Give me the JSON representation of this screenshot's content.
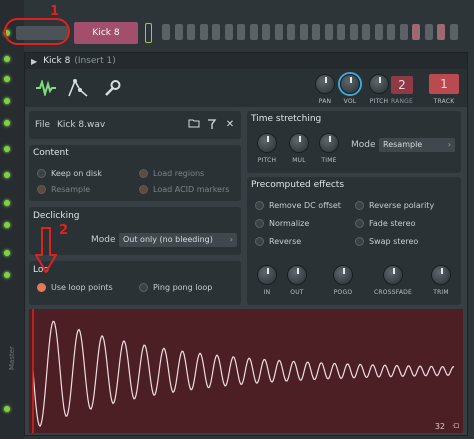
{
  "channel": {
    "name": "Kick 8"
  },
  "window": {
    "title": "Kick 8",
    "subtitle": "(Insert 1)"
  },
  "header": {
    "knobs": [
      {
        "label": "PAN"
      },
      {
        "label": "VOL"
      },
      {
        "label": "PITCH"
      }
    ],
    "range_label": "RANGE",
    "range_value": "2",
    "track_label": "TRACK",
    "track_value": "1"
  },
  "file": {
    "label": "File",
    "value": "Kick 8.wav"
  },
  "content": {
    "title": "Content",
    "options": [
      {
        "label": "Keep on disk",
        "on": false
      },
      {
        "label": "Load regions",
        "dim": true
      },
      {
        "label": "Resample",
        "dim": true
      },
      {
        "label": "Load ACID markers",
        "dim": true
      }
    ]
  },
  "declicking": {
    "title": "Declicking",
    "mode_label": "Mode",
    "mode_value": "Out only (no bleeding)"
  },
  "loop": {
    "title": "Loo",
    "options": [
      {
        "label": "Use loop points",
        "on": true
      },
      {
        "label": "Ping pong loop",
        "on": false
      }
    ]
  },
  "time_stretching": {
    "title": "Time stretching",
    "knobs": [
      "PITCH",
      "MUL",
      "TIME"
    ],
    "mode_label": "Mode",
    "mode_value": "Resample"
  },
  "precomputed": {
    "title": "Precomputed effects",
    "options": [
      "Remove DC offset",
      "Reverse polarity",
      "Normalize",
      "Fade stereo",
      "Reverse",
      "Swap stereo"
    ],
    "knobs": [
      "IN",
      "OUT",
      "POGO",
      "CROSSFADE",
      "TRIM"
    ]
  },
  "waveform": {
    "zoom_label": "32"
  },
  "annotations": {
    "one": "1",
    "two": "2"
  },
  "side_label": "Master",
  "colors": {
    "accent": "#7de07a",
    "highlight": "#e0221c",
    "wave": "#4c1f25",
    "lcd": "#8e3b45"
  }
}
